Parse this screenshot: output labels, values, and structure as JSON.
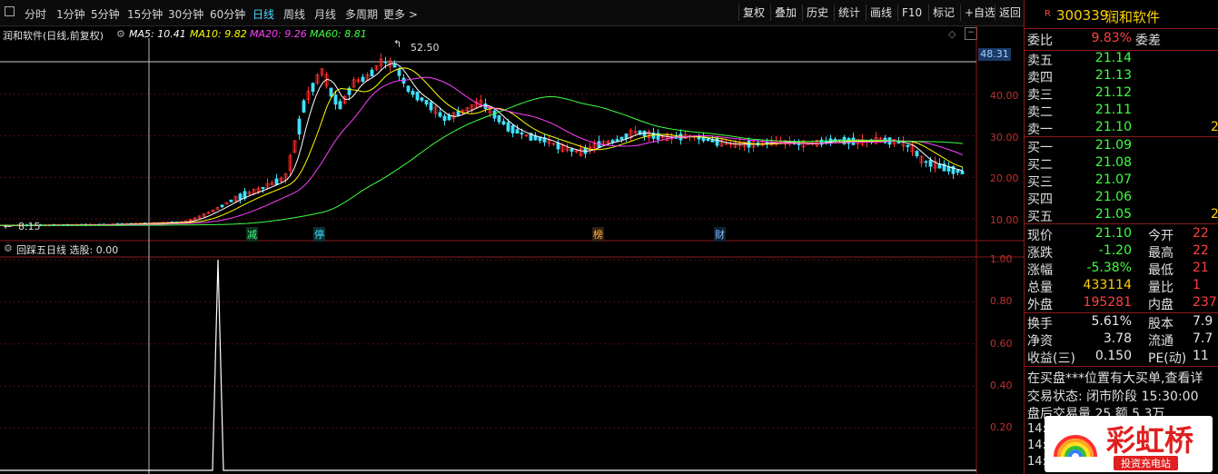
{
  "toolbar": {
    "periods": [
      "分时",
      "1分钟",
      "5分钟",
      "15分钟",
      "30分钟",
      "60分钟",
      "日线",
      "周线",
      "月线",
      "多周期",
      "更多 >"
    ],
    "active_period": "日线",
    "buttons": [
      "复权",
      "叠加",
      "历史",
      "统计",
      "画线",
      "F10",
      "标记",
      "+自选",
      "返回"
    ]
  },
  "legend": {
    "stock_title": "润和软件(日线,前复权)",
    "ma5": "MA5: 10.41",
    "ma10": "MA10: 9.82",
    "ma20": "MA20: 9.26",
    "ma60": "MA60: 8.81",
    "ma5_color": "#ffffff",
    "ma10_color": "#ffff00",
    "ma20_color": "#ff40ff",
    "ma60_color": "#40ff40"
  },
  "price_chart": {
    "high_label": "52.50",
    "low_label": "8.15",
    "price_tag": "48.31",
    "y_axis": [
      "40.00",
      "30.00",
      "20.00",
      "10.00"
    ],
    "markers": [
      "减",
      "停",
      "榜",
      "财"
    ],
    "up_color": "#ff3030",
    "down_color": "#40e0ff"
  },
  "indicator": {
    "title": "回踩五日线 选股: 0.00",
    "y_axis": [
      "1.00",
      "0.80",
      "0.60",
      "0.40",
      "0.20"
    ],
    "signal_value": 1.0
  },
  "quote": {
    "code": "300339",
    "name": "润和软件",
    "badge": "R",
    "weibi_label": "委比",
    "weibi_value": "9.83%",
    "weicha_label": "委差",
    "sells": [
      {
        "label": "卖五",
        "price": "21.14"
      },
      {
        "label": "卖四",
        "price": "21.13"
      },
      {
        "label": "卖三",
        "price": "21.12"
      },
      {
        "label": "卖二",
        "price": "21.11"
      },
      {
        "label": "卖一",
        "price": "21.10",
        "vol": "2"
      }
    ],
    "buys": [
      {
        "label": "买一",
        "price": "21.09"
      },
      {
        "label": "买二",
        "price": "21.08"
      },
      {
        "label": "买三",
        "price": "21.07"
      },
      {
        "label": "买四",
        "price": "21.06"
      },
      {
        "label": "买五",
        "price": "21.05",
        "vol": "2"
      }
    ],
    "stats": [
      {
        "l1": "现价",
        "v1": "21.10",
        "c1": "green",
        "l2": "今开",
        "v2": "22"
      },
      {
        "l1": "涨跌",
        "v1": "-1.20",
        "c1": "green",
        "l2": "最高",
        "v2": "22"
      },
      {
        "l1": "涨幅",
        "v1": "-5.38%",
        "c1": "green",
        "l2": "最低",
        "v2": "21"
      },
      {
        "l1": "总量",
        "v1": "433114",
        "c1": "yellow",
        "l2": "量比",
        "v2": "1"
      },
      {
        "l1": "外盘",
        "v1": "195281",
        "c1": "red",
        "l2": "内盘",
        "v2": "237"
      }
    ],
    "stats2": [
      {
        "l1": "换手",
        "v1": "5.61%",
        "l2": "股本",
        "v2": "7.9"
      },
      {
        "l1": "净资",
        "v1": "3.78",
        "l2": "流通",
        "v2": "7.7"
      },
      {
        "l1": "收益(三)",
        "v1": "0.150",
        "l2": "PE(动)",
        "v2": "11"
      }
    ],
    "notice": "在买盘***位置有大买单,查看详",
    "trade_status": "交易状态: 闭市阶段 15:30:00",
    "after_hours": "盘后交易量 25 额 5.3万",
    "tick_times": [
      "14:5",
      "14:5",
      "14:5"
    ]
  },
  "watermark": {
    "brand": "彩虹桥",
    "slogan": "投资充电站"
  }
}
